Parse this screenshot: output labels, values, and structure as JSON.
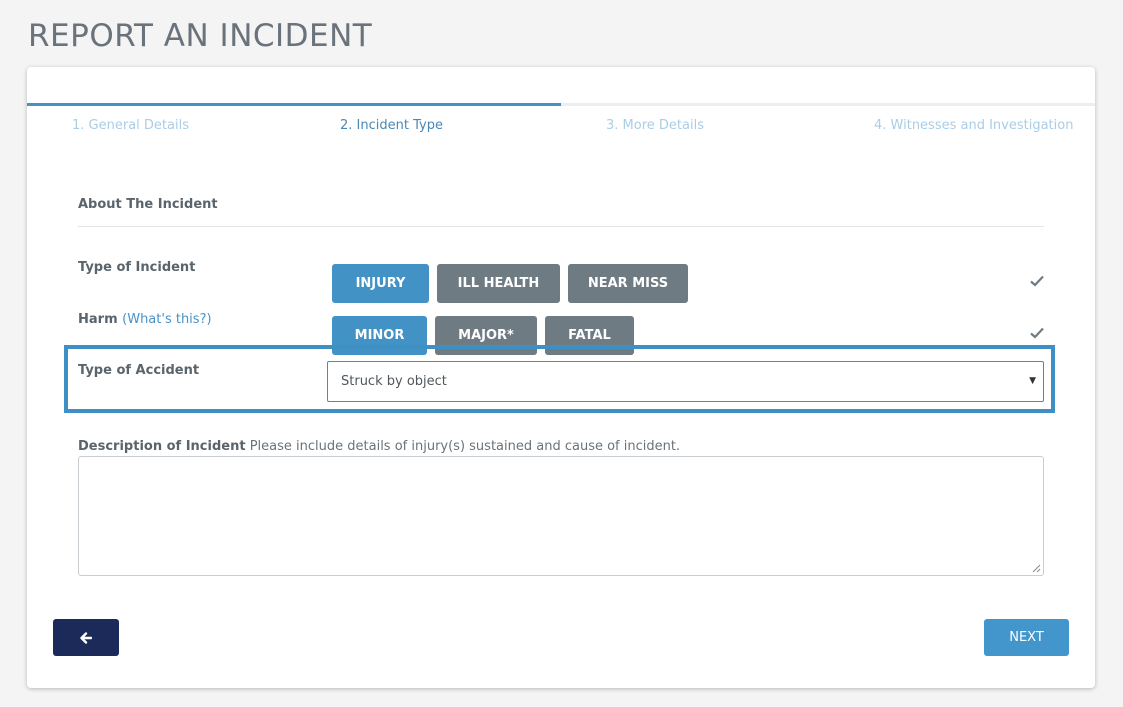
{
  "page": {
    "title": "REPORT AN INCIDENT"
  },
  "wizard": {
    "steps": [
      {
        "label": "1. General Details"
      },
      {
        "label": "2. Incident Type"
      },
      {
        "label": "3. More Details"
      },
      {
        "label": "4. Witnesses and Investigation"
      }
    ],
    "active_step": 2,
    "progress_fraction": 0.5
  },
  "section": {
    "title": "About The Incident"
  },
  "type_of_incident": {
    "label": "Type of Incident",
    "options": [
      {
        "label": "INJURY",
        "selected": true
      },
      {
        "label": "ILL HEALTH",
        "selected": false
      },
      {
        "label": "NEAR MISS",
        "selected": false
      }
    ],
    "valid_icon": "check-icon"
  },
  "harm": {
    "label": "Harm",
    "help_link": "(What's this?)",
    "options": [
      {
        "label": "MINOR",
        "selected": true
      },
      {
        "label": "MAJOR*",
        "selected": false
      },
      {
        "label": "FATAL",
        "selected": false
      }
    ],
    "valid_icon": "check-icon"
  },
  "type_of_accident": {
    "label": "Type of Accident",
    "selected_value": "Struck by object"
  },
  "description": {
    "label": "Description of Incident",
    "hint": "Please include details of injury(s) sustained and cause of incident.",
    "value": ""
  },
  "footer": {
    "back_icon": "arrow-left-icon",
    "next_label": "NEXT"
  },
  "colors": {
    "primary": "#4292c6",
    "unselected": "#6e7b83",
    "back_button": "#1c2a5a",
    "highlight": "#3d8fc4"
  }
}
